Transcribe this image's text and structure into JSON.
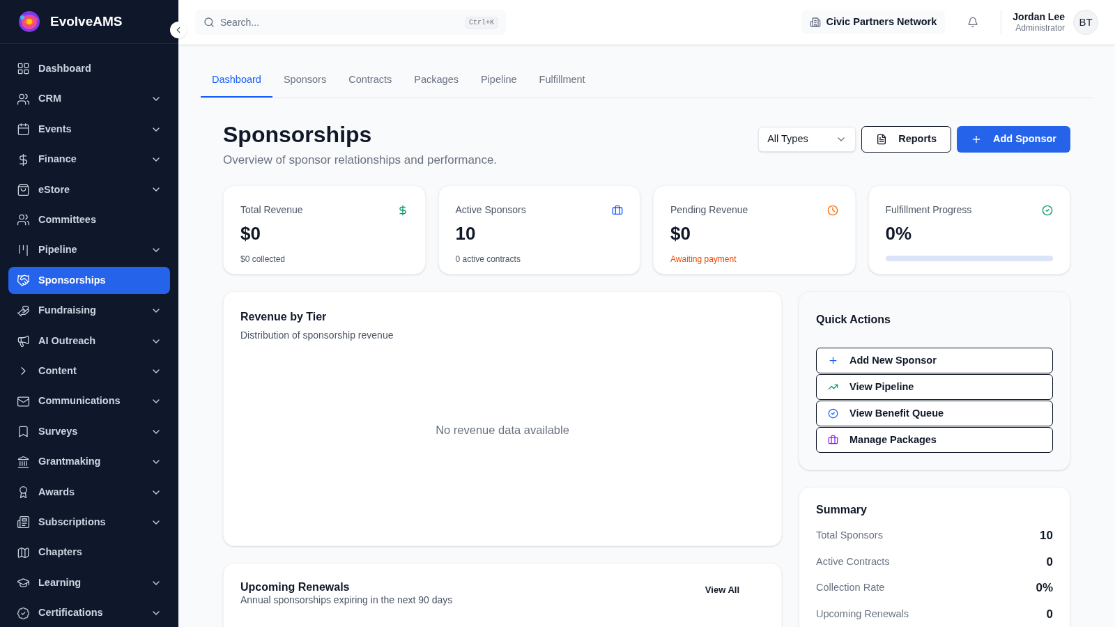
{
  "brand": {
    "name": "EvolveAMS"
  },
  "sidebar": {
    "items": [
      {
        "label": "Dashboard",
        "selected": false,
        "expandable": false
      },
      {
        "label": "CRM",
        "selected": false,
        "expandable": true
      },
      {
        "label": "Events",
        "selected": false,
        "expandable": true
      },
      {
        "label": "Finance",
        "selected": false,
        "expandable": true
      },
      {
        "label": "eStore",
        "selected": false,
        "expandable": true
      },
      {
        "label": "Committees",
        "selected": false,
        "expandable": false
      },
      {
        "label": "Pipeline",
        "selected": false,
        "expandable": true
      },
      {
        "label": "Sponsorships",
        "selected": true,
        "expandable": false
      },
      {
        "label": "Fundraising",
        "selected": false,
        "expandable": true
      },
      {
        "label": "AI Outreach",
        "selected": false,
        "expandable": true
      },
      {
        "label": "Content",
        "selected": false,
        "expandable": true
      },
      {
        "label": "Communications",
        "selected": false,
        "expandable": true
      },
      {
        "label": "Surveys",
        "selected": false,
        "expandable": true
      },
      {
        "label": "Grantmaking",
        "selected": false,
        "expandable": true
      },
      {
        "label": "Awards",
        "selected": false,
        "expandable": true
      },
      {
        "label": "Subscriptions",
        "selected": false,
        "expandable": true
      },
      {
        "label": "Chapters",
        "selected": false,
        "expandable": false
      },
      {
        "label": "Learning",
        "selected": false,
        "expandable": true
      },
      {
        "label": "Certifications",
        "selected": false,
        "expandable": true
      }
    ]
  },
  "header": {
    "search": {
      "placeholder": "Search...",
      "shortcut": "Ctrl+K"
    },
    "organization": "Civic Partners Network",
    "user": {
      "name": "Jordan Lee",
      "role": "Administrator",
      "initials": "BT"
    }
  },
  "tabs": [
    {
      "label": "Dashboard",
      "selected": true
    },
    {
      "label": "Sponsors",
      "selected": false
    },
    {
      "label": "Contracts",
      "selected": false
    },
    {
      "label": "Packages",
      "selected": false
    },
    {
      "label": "Pipeline",
      "selected": false
    },
    {
      "label": "Fulfillment",
      "selected": false
    }
  ],
  "page": {
    "title": "Sponsorships",
    "subtitle": "Overview of sponsor relationships and performance.",
    "filter": "All Types",
    "buttons": [
      {
        "label": "Reports",
        "kind": "outline"
      },
      {
        "label": "Add Sponsor",
        "kind": "primary"
      }
    ]
  },
  "stats": [
    {
      "label": "Total Revenue",
      "value": "$0",
      "kind": "note",
      "note": "$0 collected",
      "warning": false
    },
    {
      "label": "Active Sponsors",
      "value": "10",
      "kind": "note",
      "note": "0 active contracts",
      "warning": false
    },
    {
      "label": "Pending Revenue",
      "value": "$0",
      "kind": "note",
      "note": "Awaiting payment",
      "warning": true
    },
    {
      "label": "Fulfillment Progress",
      "value": "0%",
      "kind": "progress",
      "level": 0
    }
  ],
  "revenue_by_tier": {
    "title": "Revenue by Tier",
    "subtitle": "Distribution of sponsorship revenue",
    "empty": "No revenue data available"
  },
  "renewals": {
    "title": "Upcoming Renewals",
    "subtitle": "Annual sponsorships expiring in the next 90 days",
    "link": "View All"
  },
  "quick_actions": {
    "title": "Quick Actions",
    "items": [
      "Add New Sponsor",
      "View Pipeline",
      "View Benefit Queue",
      "Manage Packages"
    ]
  },
  "summary": {
    "title": "Summary",
    "rows": [
      {
        "label": "Total Sponsors",
        "value": "10"
      },
      {
        "label": "Active Contracts",
        "value": "0"
      },
      {
        "label": "Collection Rate",
        "value": "0%"
      },
      {
        "label": "Upcoming Renewals",
        "value": "0"
      }
    ]
  }
}
